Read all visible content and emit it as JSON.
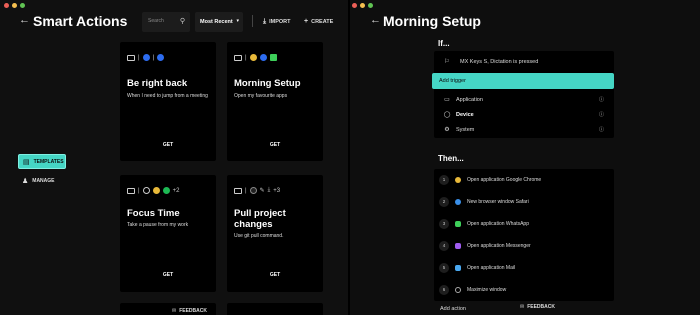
{
  "left_window": {
    "title": "Smart Actions",
    "search_placeholder": "Search",
    "sort": {
      "selected": "Most Recent"
    },
    "import_label": "IMPORT",
    "create_label": "CREATE",
    "sidebar": {
      "items": [
        {
          "label": "TEMPLATES",
          "active": true,
          "icon": "templates-icon"
        },
        {
          "label": "MANAGE",
          "active": false,
          "icon": "manage-icon"
        }
      ]
    },
    "cards": [
      {
        "title": "Be right back",
        "description": "When I need to jump from a meeting",
        "action": "GET",
        "extra": ""
      },
      {
        "title": "Morning Setup",
        "description": "Open my favourite apps",
        "action": "GET",
        "extra": ""
      },
      {
        "title": "Focus Time",
        "description": "Take a pause from my work",
        "action": "GET",
        "extra": "+2"
      },
      {
        "title": "Pull project changes",
        "description": "Use git pull command.",
        "action": "GET",
        "extra": "+3"
      }
    ],
    "feedback_label": "FEEDBACK"
  },
  "right_window": {
    "title": "Morning Setup",
    "if_label": "If...",
    "trigger": "MX Keys S, Dictation is pressed",
    "add_trigger_label": "Add trigger",
    "trigger_options": [
      {
        "label": "Application",
        "icon": "application-icon"
      },
      {
        "label": "Device",
        "icon": "device-icon"
      },
      {
        "label": "System",
        "icon": "system-icon"
      }
    ],
    "then_label": "Then...",
    "actions": [
      {
        "num": "1",
        "label": "Open application Google Chrome",
        "color": "#e8b93a"
      },
      {
        "num": "2",
        "label": "New browser window Safari",
        "color": "#3a8fe8"
      },
      {
        "num": "3",
        "label": "Open application WhatsApp",
        "color": "#3ecf5a"
      },
      {
        "num": "4",
        "label": "Open application Messenger",
        "color": "#a05cf0"
      },
      {
        "num": "5",
        "label": "Open application Mail",
        "color": "#4aa8f0"
      },
      {
        "num": "6",
        "label": "Maximize window",
        "color": "#666666"
      }
    ],
    "add_action_label": "Add action",
    "feedback_label": "FEEDBACK"
  },
  "colors": {
    "accent": "#45d6c5",
    "card_bg": "#000000",
    "window_bg": "#101010"
  }
}
